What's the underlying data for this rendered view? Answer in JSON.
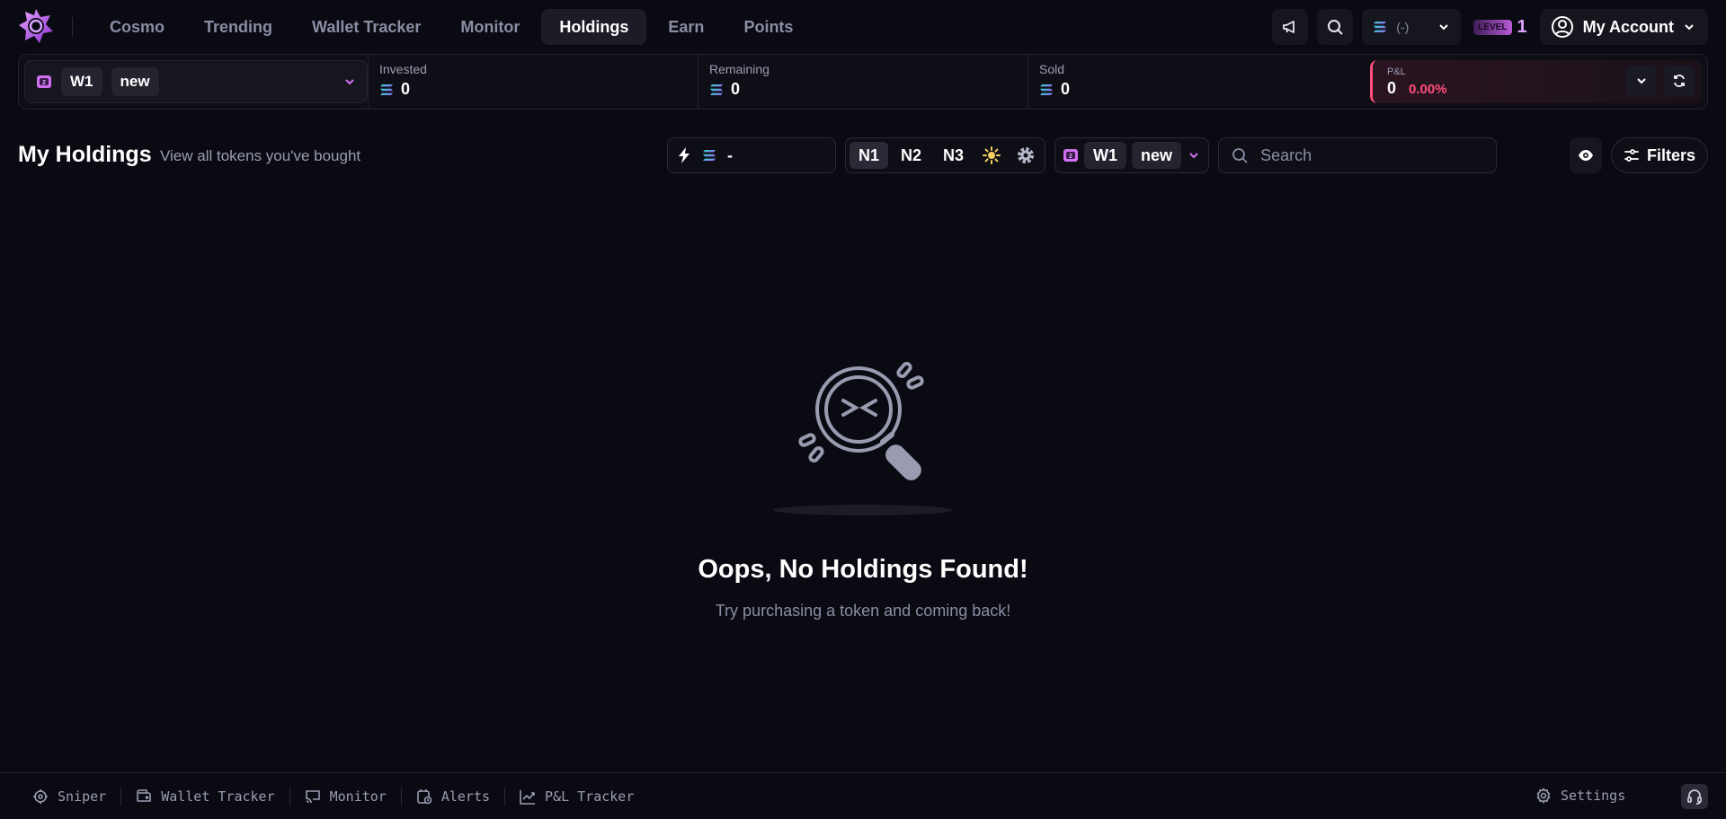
{
  "nav": {
    "tabs": [
      {
        "label": "Cosmo"
      },
      {
        "label": "Trending"
      },
      {
        "label": "Wallet Tracker"
      },
      {
        "label": "Monitor"
      },
      {
        "label": "Holdings"
      },
      {
        "label": "Earn"
      },
      {
        "label": "Points"
      }
    ],
    "active_tab": "Holdings",
    "chain_value": "(-)",
    "level_badge": "LEVEL",
    "level_number": "1",
    "account_label": "My Account"
  },
  "stats": {
    "wallet_name": "W1",
    "wallet_tag": "new",
    "wallet_count": "2",
    "invested_label": "Invested",
    "invested_value": "0",
    "remaining_label": "Remaining",
    "remaining_value": "0",
    "sold_label": "Sold",
    "sold_value": "0",
    "pnl_label": "P&L",
    "pnl_value": "0",
    "pnl_percent": "0.00%"
  },
  "holdings": {
    "title": "My Holdings",
    "subtitle": "View all tokens you've bought",
    "quick_buy_value": "-",
    "presets": [
      "N1",
      "N2",
      "N3"
    ],
    "active_preset": "N1",
    "wallet_name": "W1",
    "wallet_tag": "new",
    "wallet_count": "2",
    "search_placeholder": "Search",
    "filters_label": "Filters"
  },
  "empty_state": {
    "title": "Oops, No Holdings Found!",
    "subtitle": "Try purchasing a token and coming back!"
  },
  "footer": {
    "items": [
      {
        "label": "Sniper",
        "icon": "crosshair-icon"
      },
      {
        "label": "Wallet Tracker",
        "icon": "wallet-icon"
      },
      {
        "label": "Monitor",
        "icon": "monitor-icon"
      },
      {
        "label": "Alerts",
        "icon": "alert-icon"
      },
      {
        "label": "P&L Tracker",
        "icon": "chart-icon"
      }
    ],
    "settings_label": "Settings"
  },
  "colors": {
    "background": "#0a0a12",
    "accent_purple": "#c86cf0",
    "pnl_red": "#ff4f7c",
    "solana_gradient": [
      "#14f195",
      "#9945ff"
    ]
  }
}
